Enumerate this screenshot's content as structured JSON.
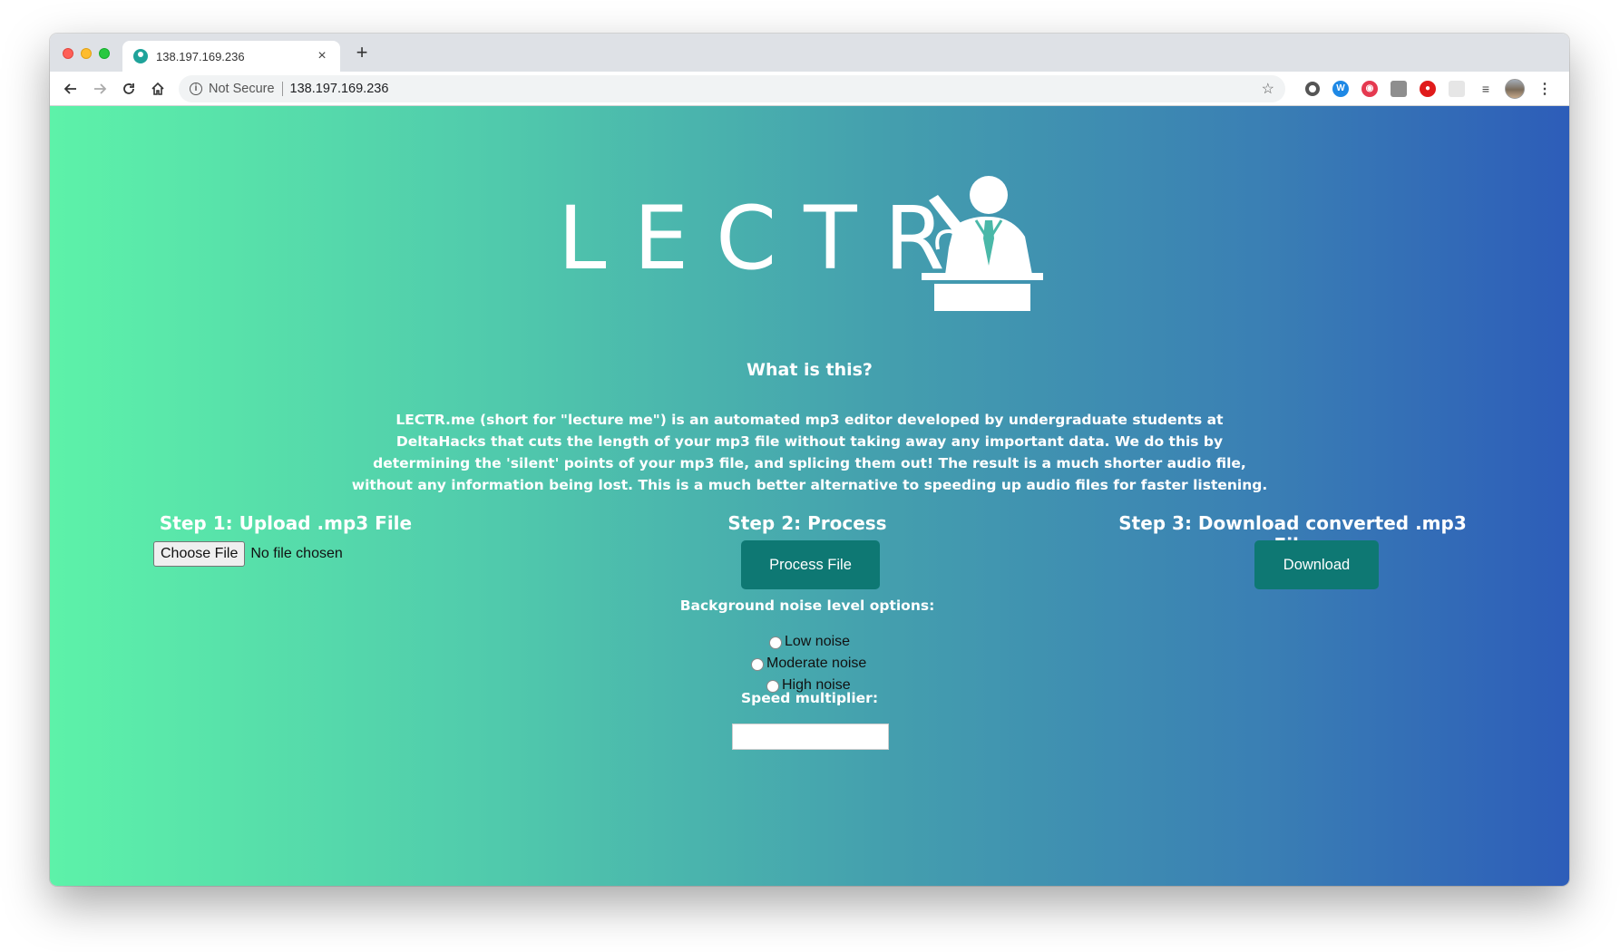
{
  "browser": {
    "tab_title": "138.197.169.236",
    "tab_close": "×",
    "new_tab": "+",
    "security_label": "Not Secure",
    "url": "138.197.169.236",
    "icons": [
      "back-arrow-icon",
      "forward-arrow-icon",
      "reload-icon",
      "home-icon",
      "info-icon",
      "star-icon",
      "menu-dots-icon"
    ]
  },
  "hero": {
    "logo_text": "LECTR"
  },
  "about": {
    "heading": "What is this?",
    "description": "LECTR.me (short for \"lecture me\") is an automated mp3 editor developed by undergraduate students at DeltaHacks that cuts the length of your mp3 file without taking away any important data. We do this by determining the 'silent' points of your mp3 file, and splicing them out! The result is a much shorter audio file, without any information being lost. This is a much better alternative to speeding up audio files for faster listening."
  },
  "step1": {
    "title": "Step 1: Upload .mp3 File",
    "choose_label": "Choose File",
    "file_status": "No file chosen"
  },
  "step2": {
    "title": "Step 2: Process",
    "button_label": "Process File",
    "noise_label": "Background noise level options:",
    "noise_options": [
      "Low noise",
      "Moderate noise",
      "High noise"
    ],
    "speed_label": "Speed multiplier:",
    "speed_value": ""
  },
  "step3": {
    "title": "Step 3: Download converted .mp3 File",
    "button_label": "Download"
  },
  "colors": {
    "gradient_start": "#5df2a9",
    "gradient_end": "#2d5db9",
    "button_teal": "#0e7873"
  }
}
